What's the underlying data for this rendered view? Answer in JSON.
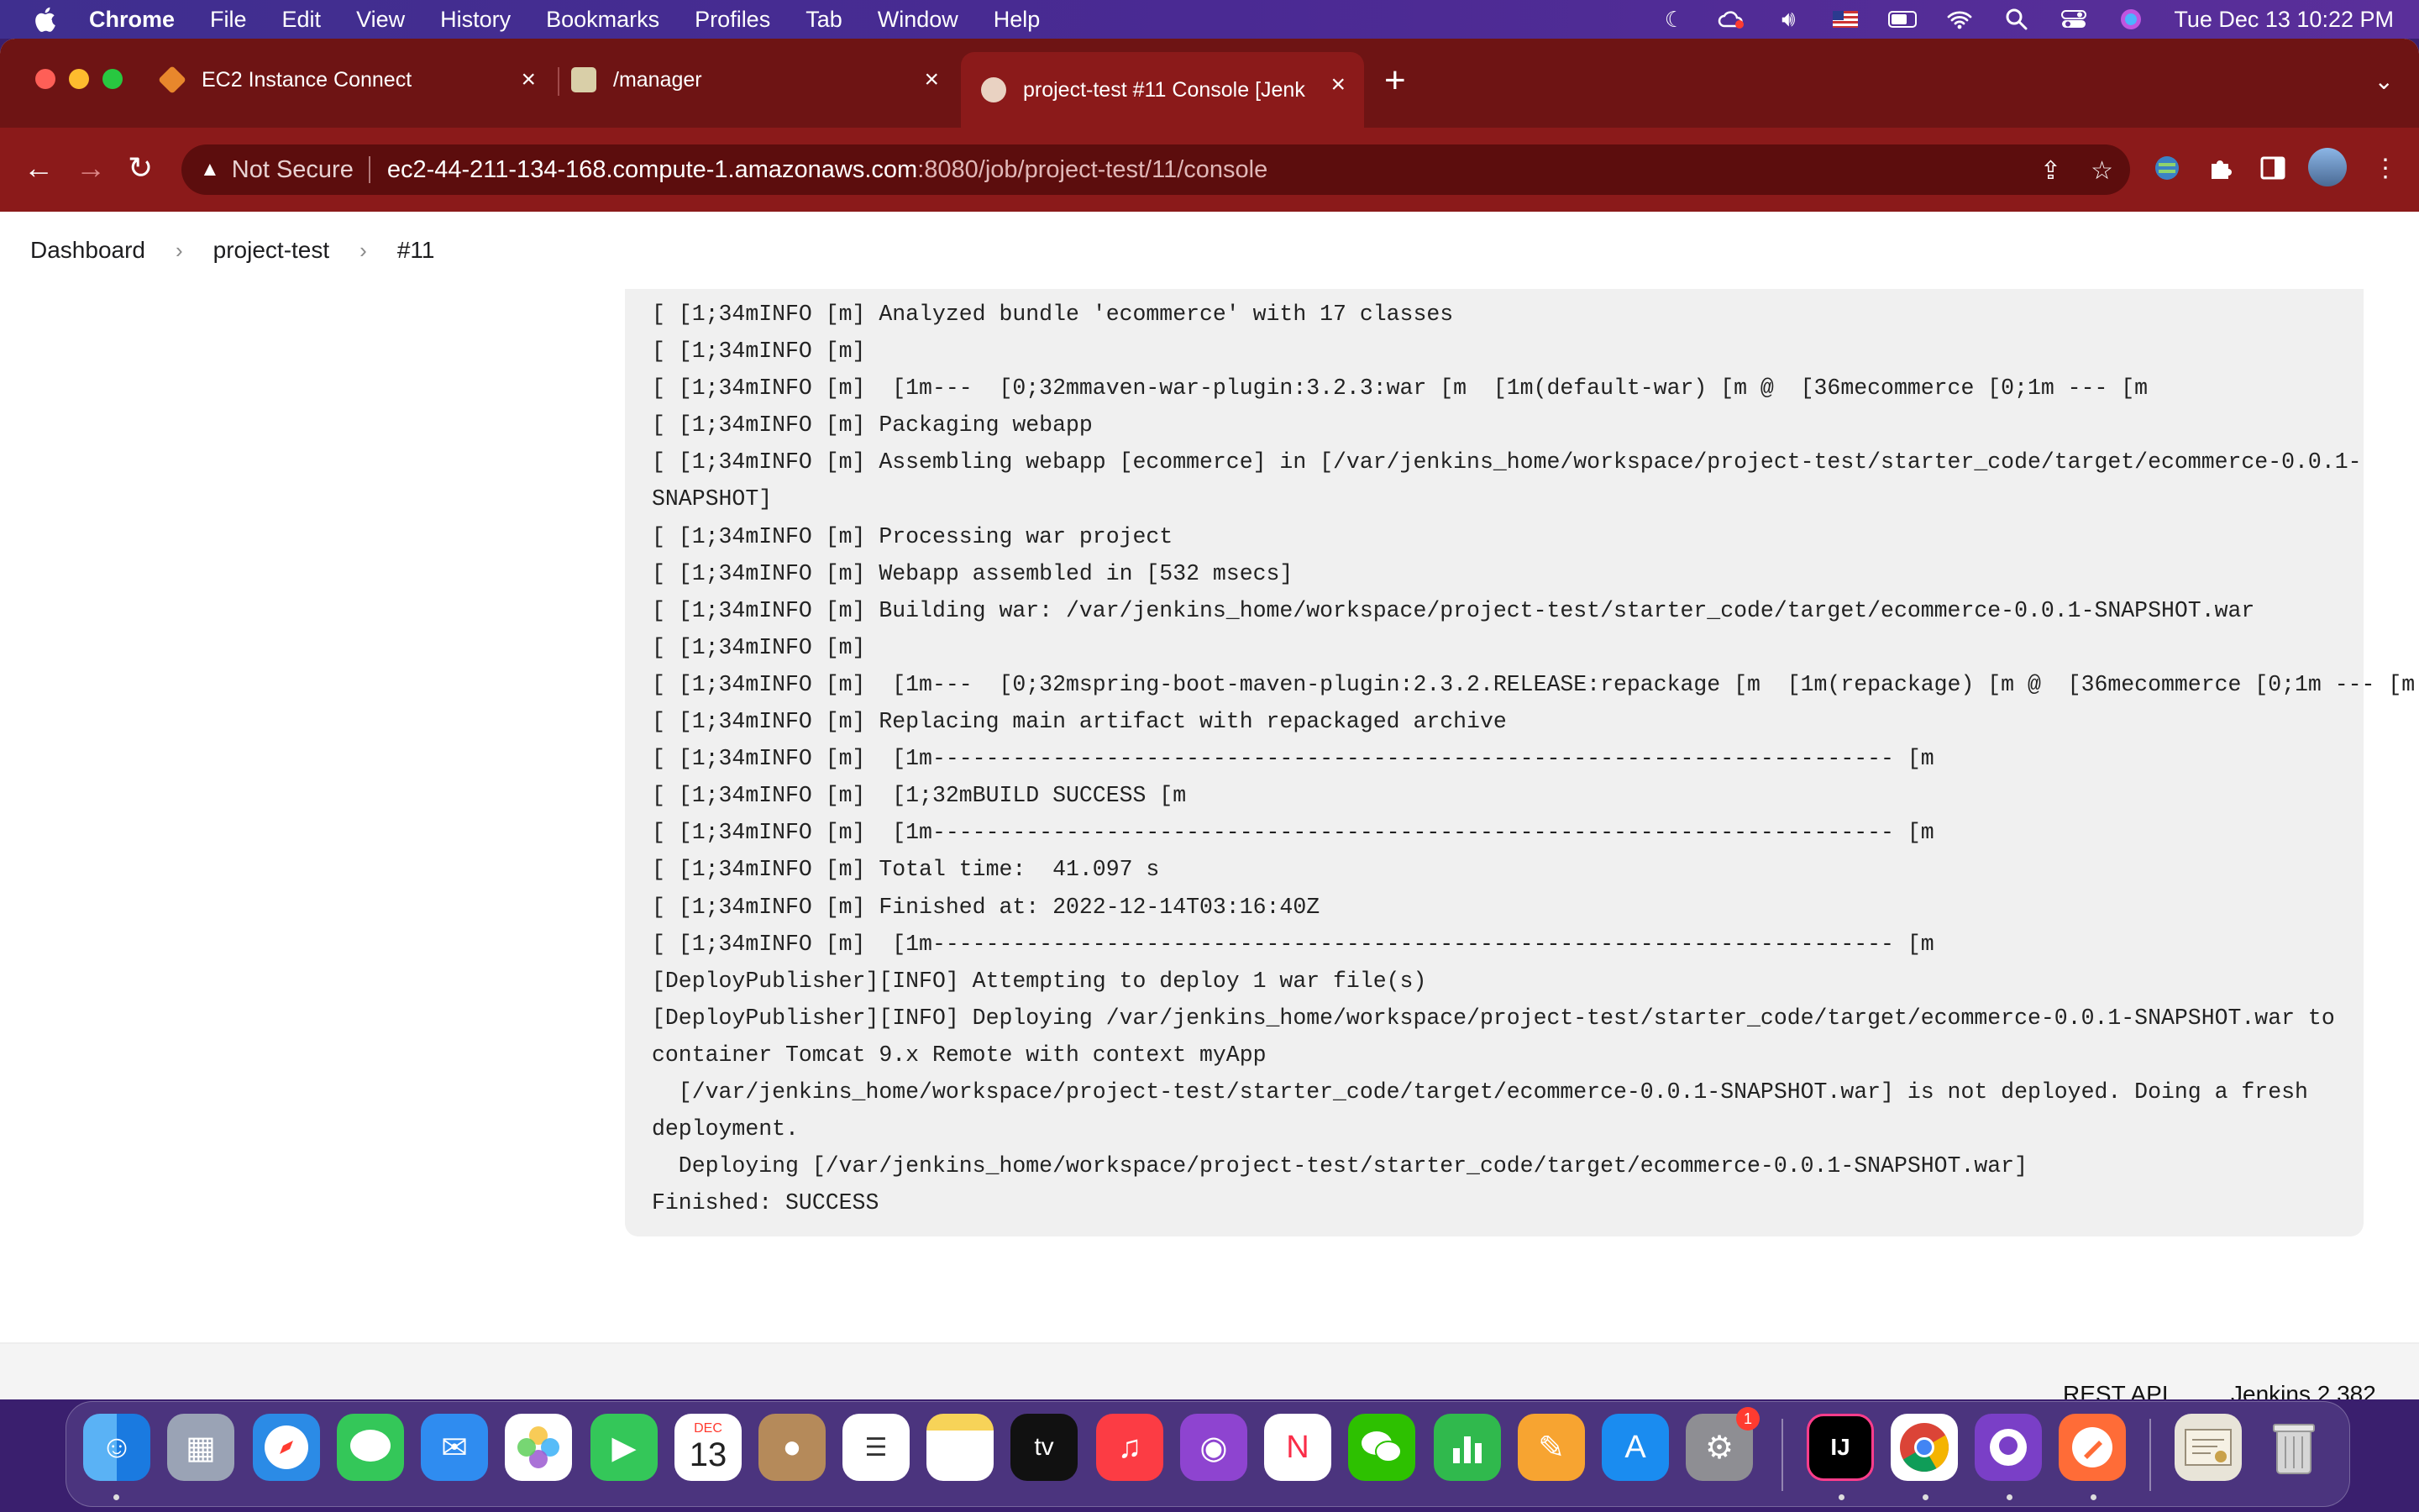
{
  "menubar": {
    "app_name": "Chrome",
    "menus": [
      "File",
      "Edit",
      "View",
      "History",
      "Bookmarks",
      "Profiles",
      "Tab",
      "Window",
      "Help"
    ],
    "datetime": "Tue Dec 13  10:22 PM"
  },
  "tabs": [
    {
      "title": "EC2 Instance Connect"
    },
    {
      "title": "/manager"
    },
    {
      "title": "project-test #11 Console [Jenk"
    }
  ],
  "toolbar": {
    "security_label": "Not Secure",
    "url_host": "ec2-44-211-134-168.compute-1.amazonaws.com",
    "url_path": ":8080/job/project-test/11/console"
  },
  "breadcrumb": {
    "items": [
      "Dashboard",
      "project-test",
      "#11"
    ]
  },
  "console": {
    "lines": [
      "[ [1;34mINFO [m] Analyzed bundle 'ecommerce' with 17 classes",
      "[ [1;34mINFO [m]",
      "[ [1;34mINFO [m]  [1m---  [0;32mmaven-war-plugin:3.2.3:war [m  [1m(default-war) [m @  [36mecommerce [0;1m --- [m",
      "[ [1;34mINFO [m] Packaging webapp",
      "[ [1;34mINFO [m] Assembling webapp [ecommerce] in [/var/jenkins_home/workspace/project-test/starter_code/target/ecommerce-0.0.1-",
      "SNAPSHOT]",
      "[ [1;34mINFO [m] Processing war project",
      "[ [1;34mINFO [m] Webapp assembled in [532 msecs]",
      "[ [1;34mINFO [m] Building war: /var/jenkins_home/workspace/project-test/starter_code/target/ecommerce-0.0.1-SNAPSHOT.war",
      "[ [1;34mINFO [m]",
      "[ [1;34mINFO [m]  [1m---  [0;32mspring-boot-maven-plugin:2.3.2.RELEASE:repackage [m  [1m(repackage) [m @  [36mecommerce [0;1m --- [m",
      "[ [1;34mINFO [m] Replacing main artifact with repackaged archive",
      "[ [1;34mINFO [m]  [1m------------------------------------------------------------------------ [m",
      "[ [1;34mINFO [m]  [1;32mBUILD SUCCESS [m",
      "[ [1;34mINFO [m]  [1m------------------------------------------------------------------------ [m",
      "[ [1;34mINFO [m] Total time:  41.097 s",
      "[ [1;34mINFO [m] Finished at: 2022-12-14T03:16:40Z",
      "[ [1;34mINFO [m]  [1m------------------------------------------------------------------------ [m",
      "[DeployPublisher][INFO] Attempting to deploy 1 war file(s)",
      "[DeployPublisher][INFO] Deploying /var/jenkins_home/workspace/project-test/starter_code/target/ecommerce-0.0.1-SNAPSHOT.war to",
      "container Tomcat 9.x Remote with context myApp",
      "  [/var/jenkins_home/workspace/project-test/starter_code/target/ecommerce-0.0.1-SNAPSHOT.war] is not deployed. Doing a fresh",
      "deployment.",
      "  Deploying [/var/jenkins_home/workspace/project-test/starter_code/target/ecommerce-0.0.1-SNAPSHOT.war]",
      "Finished: SUCCESS"
    ]
  },
  "footer": {
    "rest_api": "REST API",
    "version": "Jenkins 2.382"
  },
  "dock": {
    "calendar_month": "DEC",
    "calendar_day": "13",
    "system_settings_badge": "1",
    "intellij_label": "IJ",
    "apps": [
      "finder-icon",
      "launchpad-icon",
      "safari-icon",
      "messages-icon",
      "mail-icon",
      "photos-icon",
      "facetime-icon",
      "calendar-icon",
      "contacts-icon",
      "reminders-icon",
      "notes-icon",
      "appletv-icon",
      "music-icon",
      "podcasts-icon",
      "news-icon",
      "wechat-icon",
      "numbers-icon",
      "pages-icon",
      "appstore-icon",
      "system-settings-icon",
      "intellij-icon",
      "chrome-icon",
      "github-desktop-icon",
      "postman-icon",
      "certificate-icon",
      "trash-icon"
    ]
  },
  "colors": {
    "tab_strip": "#6e1414",
    "toolbar": "#8b1a1a",
    "console_bg": "#f0f0f0"
  }
}
